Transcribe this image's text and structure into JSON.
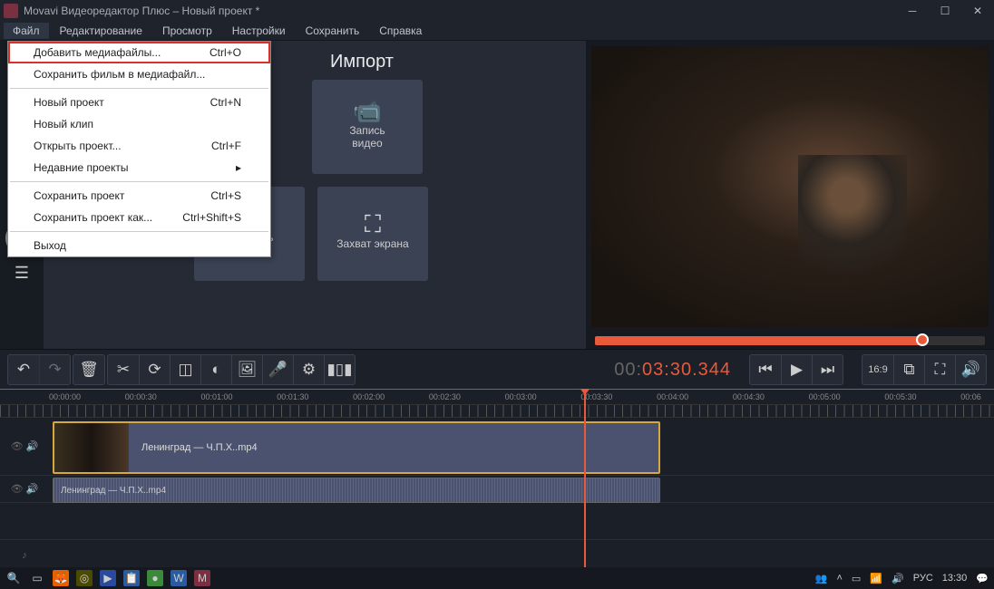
{
  "window": {
    "title": "Movavi Видеоредактор Плюс – Новый проект *"
  },
  "menubar": [
    "Файл",
    "Редактирование",
    "Просмотр",
    "Настройки",
    "Сохранить",
    "Справка"
  ],
  "dropdown": {
    "groups": [
      [
        {
          "label": "Добавить медиафайлы...",
          "shortcut": "Ctrl+O",
          "highlight": true
        },
        {
          "label": "Сохранить фильм в медиафайл...",
          "shortcut": ""
        }
      ],
      [
        {
          "label": "Новый проект",
          "shortcut": "Ctrl+N"
        },
        {
          "label": "Новый клип",
          "shortcut": ""
        },
        {
          "label": "Открыть проект...",
          "shortcut": "Ctrl+F"
        },
        {
          "label": "Недавние проекты",
          "shortcut": "▸"
        }
      ],
      [
        {
          "label": "Сохранить проект",
          "shortcut": "Ctrl+S"
        },
        {
          "label": "Сохранить проект как...",
          "shortcut": "Ctrl+Shift+S"
        }
      ],
      [
        {
          "label": "Выход",
          "shortcut": ""
        }
      ]
    ]
  },
  "import": {
    "title": "Импорт",
    "tiles": {
      "record_video": "Запись\nвидео",
      "add_folder": "Добавить\nпапку",
      "screen_capture": "Захват экрана"
    }
  },
  "timecode": {
    "gray": "00:",
    "main": "03:30.344"
  },
  "aspect_ratio": "16:9",
  "ruler": [
    "00:00:00",
    "00:00:30",
    "00:01:00",
    "00:01:30",
    "00:02:00",
    "00:02:30",
    "00:03:00",
    "00:03:30",
    "00:04:00",
    "00:04:30",
    "00:05:00",
    "00:05:30",
    "00:06"
  ],
  "clips": {
    "video": "Ленинград — Ч.П.Х..mp4",
    "audio": "Ленинград — Ч.П.Х..mp4"
  },
  "taskbar": {
    "lang": "РУС",
    "time": "13:30"
  }
}
